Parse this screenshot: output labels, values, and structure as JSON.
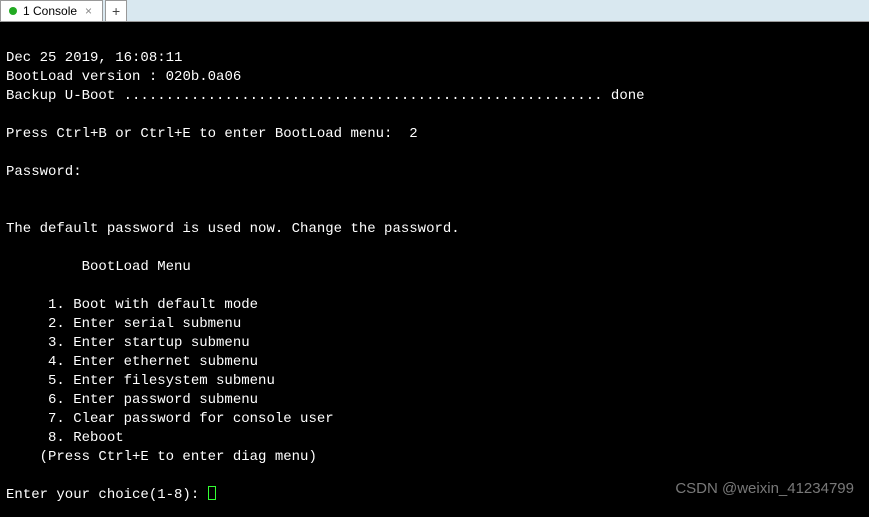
{
  "tabbar": {
    "tab_label": "1 Console",
    "tab_close": "×",
    "new_tab": "+"
  },
  "console": {
    "timestamp": "Dec 25 2019, 16:08:11",
    "bootload_version_label": "BootLoad version : ",
    "bootload_version": "020b.0a06",
    "backup_label": "Backup U-Boot ",
    "backup_dots": ".........................................................",
    "backup_status": " done",
    "press_menu": "Press Ctrl+B or Ctrl+E to enter BootLoad menu:  ",
    "countdown": "2",
    "password_prompt": "Password:",
    "default_pw_msg": "The default password is used now. Change the password.",
    "menu_title": "         BootLoad Menu",
    "menu_items": [
      "     1. Boot with default mode",
      "     2. Enter serial submenu",
      "     3. Enter startup submenu",
      "     4. Enter ethernet submenu",
      "     5. Enter filesystem submenu",
      "     6. Enter password submenu",
      "     7. Clear password for console user",
      "     8. Reboot"
    ],
    "diag_hint": "    (Press Ctrl+E to enter diag menu)",
    "choice_prompt": "Enter your choice(1-8): "
  },
  "watermark": "CSDN @weixin_41234799"
}
